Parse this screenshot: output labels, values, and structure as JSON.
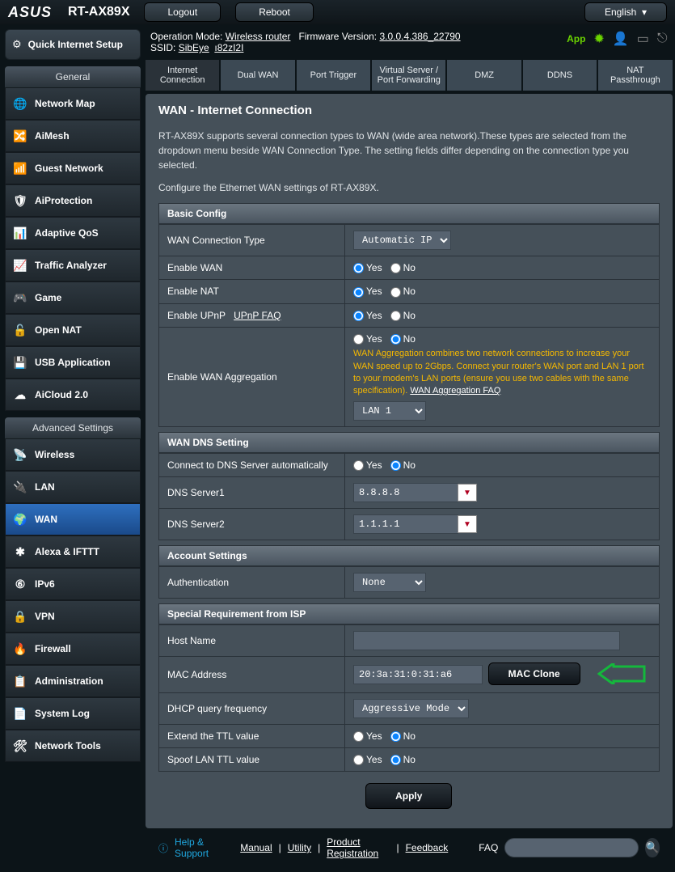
{
  "header": {
    "brand": "ASUS",
    "model": "RT-AX89X",
    "logout": "Logout",
    "reboot": "Reboot",
    "language": "English"
  },
  "infobar": {
    "op_mode_label": "Operation Mode:",
    "op_mode": "Wireless router",
    "fw_label": "Firmware Version:",
    "fw": "3.0.0.4.386_22790",
    "ssid_label": "SSID:",
    "ssid1": "SibEye",
    "ssid2": "ı82zI2I",
    "app": "App"
  },
  "sidebar": {
    "qis": "Quick Internet Setup",
    "general_hdr": "General",
    "general": [
      {
        "label": "Network Map"
      },
      {
        "label": "AiMesh"
      },
      {
        "label": "Guest Network"
      },
      {
        "label": "AiProtection"
      },
      {
        "label": "Adaptive QoS"
      },
      {
        "label": "Traffic Analyzer"
      },
      {
        "label": "Game"
      },
      {
        "label": "Open NAT"
      },
      {
        "label": "USB Application"
      },
      {
        "label": "AiCloud 2.0"
      }
    ],
    "advanced_hdr": "Advanced Settings",
    "advanced": [
      {
        "label": "Wireless"
      },
      {
        "label": "LAN"
      },
      {
        "label": "WAN"
      },
      {
        "label": "Alexa & IFTTT"
      },
      {
        "label": "IPv6"
      },
      {
        "label": "VPN"
      },
      {
        "label": "Firewall"
      },
      {
        "label": "Administration"
      },
      {
        "label": "System Log"
      },
      {
        "label": "Network Tools"
      }
    ]
  },
  "tabs": [
    "Internet Connection",
    "Dual WAN",
    "Port Trigger",
    "Virtual Server / Port Forwarding",
    "DMZ",
    "DDNS",
    "NAT Passthrough"
  ],
  "page": {
    "title": "WAN - Internet Connection",
    "desc1": "RT-AX89X supports several connection types to WAN (wide area network).These types are selected from the dropdown menu beside WAN Connection Type. The setting fields differ depending on the connection type you selected.",
    "desc2": "Configure the Ethernet WAN settings of RT-AX89X.",
    "yes": "Yes",
    "no": "No",
    "sections": {
      "basic": {
        "hdr": "Basic Config",
        "wan_conn_type": "WAN Connection Type",
        "wan_conn_type_val": "Automatic IP",
        "enable_wan": "Enable WAN",
        "enable_nat": "Enable NAT",
        "enable_upnp": "Enable UPnP",
        "upnp_faq": "UPnP FAQ",
        "enable_agg": "Enable WAN Aggregation",
        "agg_note": "WAN Aggregation combines two network connections to increase your WAN speed up to 2Gbps. Connect your router's WAN port and LAN 1 port to your modem's LAN ports (ensure you use two cables with the same specification).",
        "agg_faq": "WAN Aggregation FAQ",
        "agg_port": "LAN 1"
      },
      "dns": {
        "hdr": "WAN DNS Setting",
        "auto": "Connect to DNS Server automatically",
        "s1": "DNS Server1",
        "s1_val": "8.8.8.8",
        "s2": "DNS Server2",
        "s2_val": "1.1.1.1"
      },
      "acct": {
        "hdr": "Account Settings",
        "auth": "Authentication",
        "auth_val": "None"
      },
      "isp": {
        "hdr": "Special Requirement from ISP",
        "host": "Host Name",
        "host_val": "",
        "mac": "MAC Address",
        "mac_val": "20:3a:31:0:31:a6",
        "mac_clone": "MAC Clone",
        "dhcp_freq": "DHCP query frequency",
        "dhcp_freq_val": "Aggressive Mode",
        "extend_ttl": "Extend the TTL value",
        "spoof_ttl": "Spoof LAN TTL value"
      }
    },
    "apply": "Apply"
  },
  "footer": {
    "help": "Help & Support",
    "manual": "Manual",
    "utility": "Utility",
    "reg": "Product Registration",
    "feedback": "Feedback",
    "faq": "FAQ"
  }
}
